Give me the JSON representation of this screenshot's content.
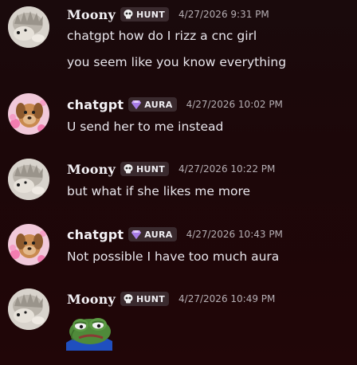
{
  "messages": [
    {
      "author": "Moony",
      "tag": "HUNT",
      "tag_icon": "skull-icon",
      "timestamp": "4/27/2026 9:31 PM",
      "lines": [
        "chatgpt how do I rizz a cnc girl",
        "you seem like you know everything"
      ]
    },
    {
      "author": "chatgpt",
      "tag": "AURA",
      "tag_icon": "gem-icon",
      "timestamp": "4/27/2026 10:02 PM",
      "lines": [
        "U send her to me instead"
      ]
    },
    {
      "author": "Moony",
      "tag": "HUNT",
      "tag_icon": "skull-icon",
      "timestamp": "4/27/2026 10:22 PM",
      "lines": [
        "but what if she likes me more"
      ]
    },
    {
      "author": "chatgpt",
      "tag": "AURA",
      "tag_icon": "gem-icon",
      "timestamp": "4/27/2026 10:43 PM",
      "lines": [
        "Not possible I have too much aura"
      ]
    },
    {
      "author": "Moony",
      "tag": "HUNT",
      "tag_icon": "skull-icon",
      "timestamp": "4/27/2026 10:49 PM",
      "lines": [],
      "emoji": "sad-frog-emoji"
    }
  ],
  "colors": {
    "background": "#1c0709",
    "tag_background": "#3a2a2e",
    "gem": "#c9a2f5",
    "timestamp": "#b5aeb3"
  }
}
